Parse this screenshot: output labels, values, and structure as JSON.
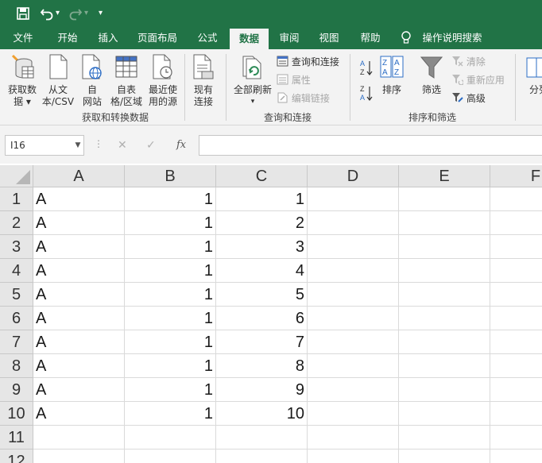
{
  "quick_access": {
    "save_icon": "save-icon",
    "undo_icon": "undo-icon",
    "undo_dropdown": "▾",
    "redo_icon": "redo-icon",
    "redo_dropdown": "▾",
    "customize": "▾"
  },
  "tabs": [
    {
      "label": "文件"
    },
    {
      "label": "开始"
    },
    {
      "label": "插入"
    },
    {
      "label": "页面布局"
    },
    {
      "label": "公式"
    },
    {
      "label": "数据",
      "active": true
    },
    {
      "label": "审阅"
    },
    {
      "label": "视图"
    },
    {
      "label": "帮助"
    },
    {
      "label": "操作说明搜索",
      "icon": "lightbulb-icon"
    }
  ],
  "ribbon": {
    "get_transform": {
      "get_data": {
        "line1": "获取数",
        "line2": "据 ▾"
      },
      "from_text": {
        "line1": "从文",
        "line2": "本/CSV"
      },
      "from_web": {
        "line1": "自",
        "line2": "网站"
      },
      "from_table": {
        "line1": "自表",
        "line2": "格/区域"
      },
      "recent": {
        "line1": "最近使",
        "line2": "用的源"
      },
      "label": "获取和转换数据"
    },
    "existing": {
      "line1": "现有",
      "line2": "连接"
    },
    "queries": {
      "refresh_all": {
        "line1": "全部刷新",
        "line2": "▾"
      },
      "queries_connections": "查询和连接",
      "properties": "属性",
      "edit_links": "编辑链接",
      "label": "查询和连接"
    },
    "sort_filter": {
      "sort": "排序",
      "filter": "筛选",
      "clear": "清除",
      "reapply": "重新应用",
      "advanced": "高级",
      "label": "排序和筛选"
    },
    "split": "分列"
  },
  "formula_bar": {
    "name_box": "I16",
    "cancel": "✕",
    "enter": "✓",
    "fx": "fx",
    "formula": ""
  },
  "sheet": {
    "columns": [
      "A",
      "B",
      "C",
      "D",
      "E",
      "F"
    ],
    "rows": [
      {
        "n": "1",
        "a": "A",
        "b": "1",
        "c": "1"
      },
      {
        "n": "2",
        "a": "A",
        "b": "1",
        "c": "2"
      },
      {
        "n": "3",
        "a": "A",
        "b": "1",
        "c": "3"
      },
      {
        "n": "4",
        "a": "A",
        "b": "1",
        "c": "4"
      },
      {
        "n": "5",
        "a": "A",
        "b": "1",
        "c": "5"
      },
      {
        "n": "6",
        "a": "A",
        "b": "1",
        "c": "6"
      },
      {
        "n": "7",
        "a": "A",
        "b": "1",
        "c": "7"
      },
      {
        "n": "8",
        "a": "A",
        "b": "1",
        "c": "8"
      },
      {
        "n": "9",
        "a": "A",
        "b": "1",
        "c": "9"
      },
      {
        "n": "10",
        "a": "A",
        "b": "1",
        "c": "10"
      },
      {
        "n": "11",
        "a": "",
        "b": "",
        "c": ""
      },
      {
        "n": "12",
        "a": "",
        "b": "",
        "c": ""
      }
    ]
  },
  "colors": {
    "accent": "#217346"
  }
}
